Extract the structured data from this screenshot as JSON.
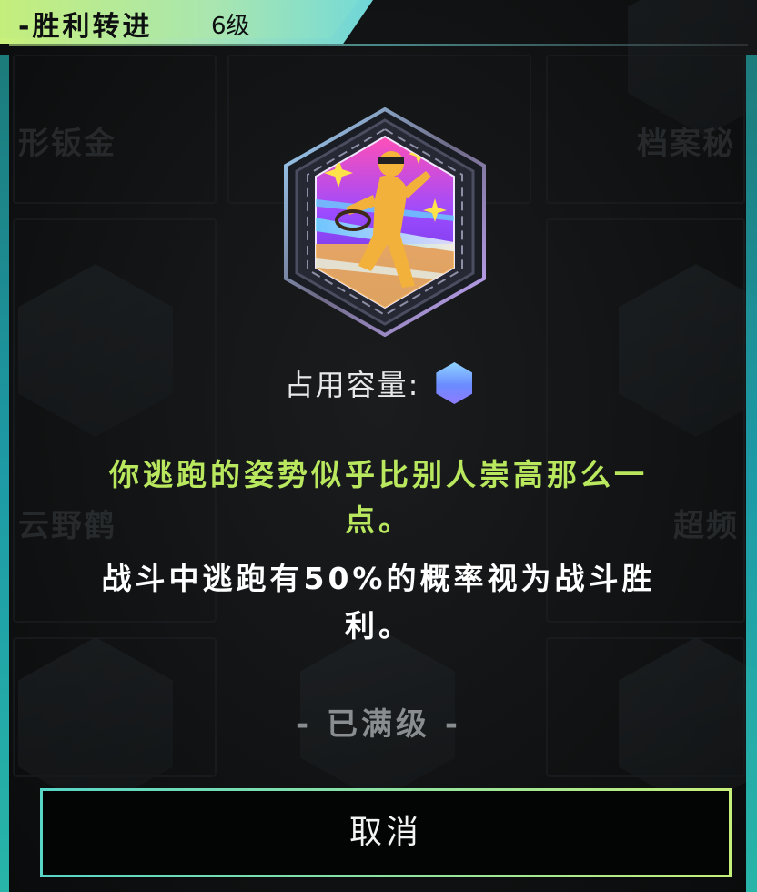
{
  "header": {
    "title": "-胜利转进",
    "level": "6级"
  },
  "background_tiles": [
    {
      "label": "形钣金"
    },
    {
      "label": "档案秘"
    },
    {
      "label": "云野鹤"
    },
    {
      "label": "超频"
    }
  ],
  "chip": {
    "icon": "running-figure-badge-icon",
    "capacity_label": "占用容量:",
    "capacity_value": 1
  },
  "flavor_text": "你逃跑的姿势似乎比别人崇高那么一点。",
  "effect_text": "战斗中逃跑有50%的概率视为战斗胜利。",
  "status": {
    "max_level": "- 已满级 -"
  },
  "actions": {
    "cancel_label": "取消"
  },
  "colors": {
    "accent_green": "#b9e85f",
    "accent_teal": "#2dd3c4",
    "capacity_hex": "#7f9bff"
  }
}
